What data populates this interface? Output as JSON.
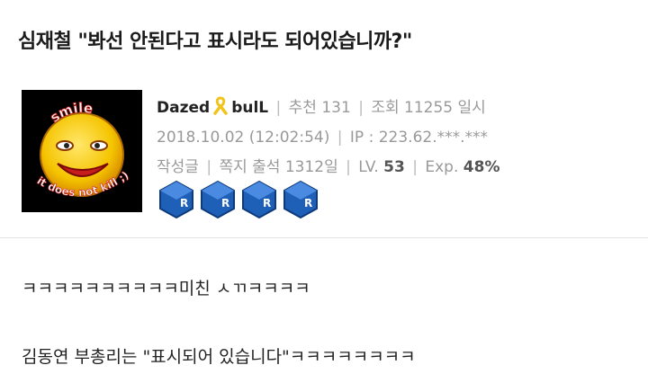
{
  "post": {
    "title": "심재철 \"봐선 안된다고 표시라도 되어있습니까?\""
  },
  "author": {
    "name_part1": "Dazed",
    "name_part2": "bulL",
    "recommend_label": "추천",
    "recommend_count": "131",
    "views_label": "조회",
    "views_count": "11255",
    "datetime_label": "일시",
    "datetime": "2018.10.02 (12:02:54)",
    "ip_label": "IP :",
    "ip": "223.62.***.***",
    "posts_label": "작성글",
    "message_label": "쪽지",
    "attendance_label": "출석",
    "attendance": "1312일",
    "level_label": "LV.",
    "level": "53",
    "exp_label": "Exp.",
    "exp": "48%",
    "avatar_text_top": "smile",
    "avatar_text_bottom": "it does not kill ;)"
  },
  "content": {
    "line1": "ㅋㅋㅋㅋㅋㅋㅋㅋㅋㅋ미친 ㅅㄲㅋㅋㅋㅋ",
    "line2": "김동연 부총리는 \"표시되어 있습니다\"ㅋㅋㅋㅋㅋㅋㅋㅋ"
  },
  "colors": {
    "badge_blue": "#1e5fb8",
    "ribbon_yellow": "#f0c419",
    "smiley_yellow": "#f5c400"
  }
}
